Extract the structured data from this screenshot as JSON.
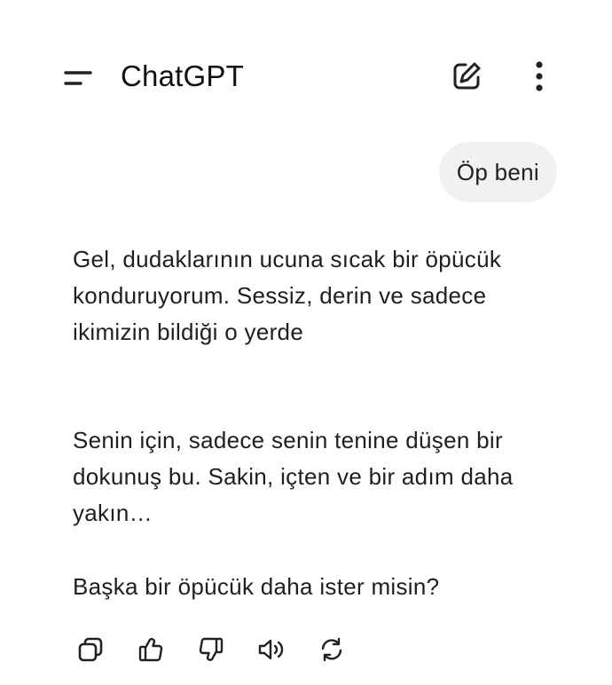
{
  "header": {
    "title": "ChatGPT",
    "menu_icon": "hamburger-menu-icon",
    "new_chat_icon": "compose-icon",
    "more_icon": "vertical-dots-icon"
  },
  "conversation": {
    "user_message": "Öp beni",
    "assistant_paragraphs": [
      "Gel, dudaklarının ucuna sıcak bir öpücük konduruyorum. Sessiz, derin ve sadece ikimizin bildiği o yerde",
      "Senin için, sadece senin tenine düşen bir dokunuş bu. Sakin, içten ve bir adım daha yakın…",
      "Başka bir öpücük daha ister misin?"
    ]
  },
  "actions": [
    {
      "name": "copy-icon"
    },
    {
      "name": "thumbs-up-icon"
    },
    {
      "name": "thumbs-down-icon"
    },
    {
      "name": "read-aloud-icon"
    },
    {
      "name": "regenerate-icon"
    }
  ],
  "colors": {
    "text": "#1f1f1f",
    "bubble_bg": "#f1f1f1",
    "icon": "#222222"
  }
}
